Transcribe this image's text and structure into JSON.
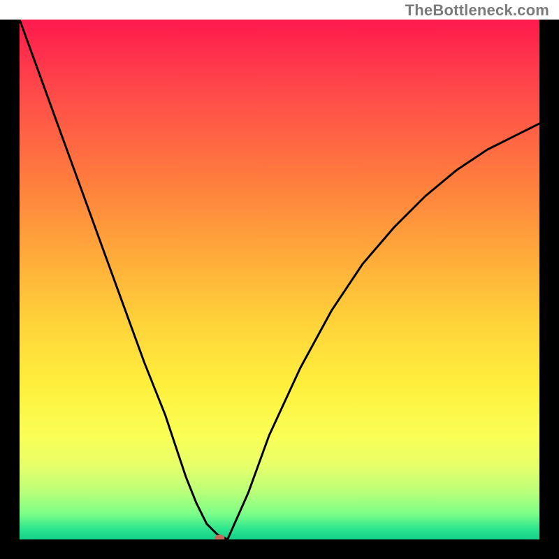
{
  "attribution": "TheBottleneck.com",
  "chart_data": {
    "type": "line",
    "title": "",
    "xlabel": "",
    "ylabel": "",
    "axes_hidden": true,
    "xlim": [
      0,
      100
    ],
    "ylim": [
      0,
      100
    ],
    "background_gradient": {
      "direction": "vertical",
      "stops": [
        {
          "pos": 0,
          "color": "#ff1a4d"
        },
        {
          "pos": 14,
          "color": "#ff4a4a"
        },
        {
          "pos": 30,
          "color": "#ff7a3e"
        },
        {
          "pos": 44,
          "color": "#ffa63a"
        },
        {
          "pos": 58,
          "color": "#ffd23a"
        },
        {
          "pos": 70,
          "color": "#ffef3c"
        },
        {
          "pos": 80,
          "color": "#faff55"
        },
        {
          "pos": 86,
          "color": "#e6ff6a"
        },
        {
          "pos": 91,
          "color": "#b8ff7a"
        },
        {
          "pos": 95,
          "color": "#7dff88"
        },
        {
          "pos": 98,
          "color": "#2de58f"
        },
        {
          "pos": 100,
          "color": "#12d08a"
        }
      ]
    },
    "series": [
      {
        "name": "bottleneck-curve",
        "color": "#000000",
        "stroke_width": 3,
        "x": [
          0,
          4,
          8,
          12,
          16,
          20,
          24,
          28,
          30,
          32,
          34,
          36,
          38,
          40,
          44,
          48,
          54,
          60,
          66,
          72,
          78,
          84,
          90,
          96,
          100
        ],
        "values": [
          100,
          89,
          78,
          67,
          56,
          45,
          34,
          24,
          18,
          12,
          7,
          3,
          1,
          0,
          9,
          20,
          33,
          44,
          53,
          60,
          66,
          71,
          75,
          78,
          80
        ]
      }
    ],
    "marker": {
      "name": "min-point",
      "x": 38.5,
      "y": 0,
      "color": "#c46a5a",
      "rx": 7,
      "ry": 5
    }
  }
}
